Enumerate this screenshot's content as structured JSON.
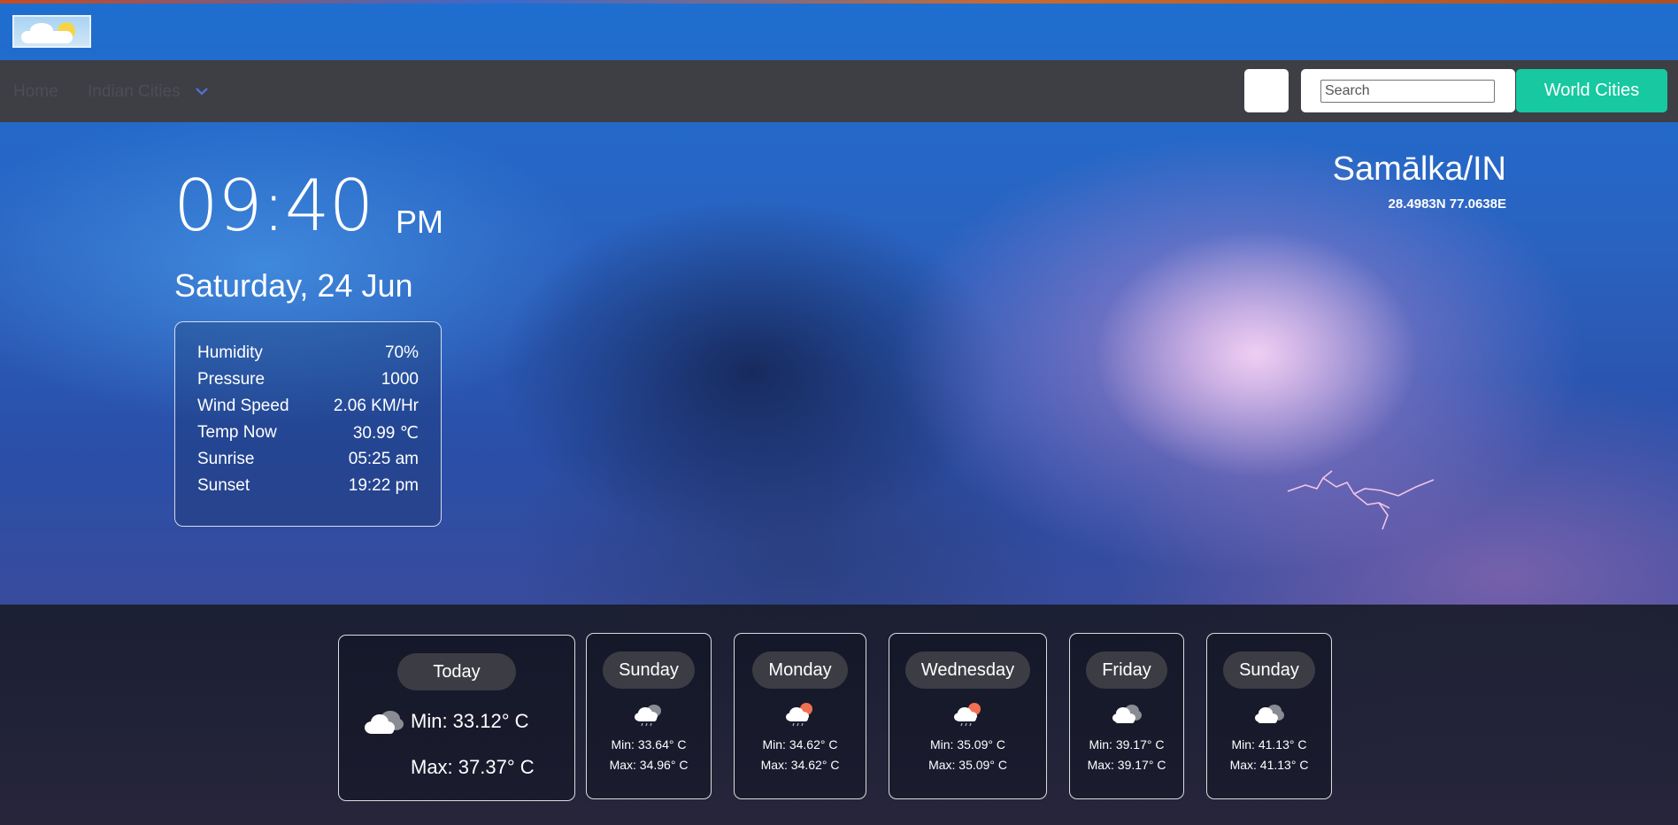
{
  "nav": {
    "home": "Home",
    "indian_cities": "Indian Cities",
    "search_placeholder": "Search",
    "world_cities": "World Cities"
  },
  "clock": {
    "time": "09:40",
    "ampm": "PM",
    "date": "Saturday, 24 Jun"
  },
  "stats": [
    {
      "label": "Humidity",
      "value": "70%"
    },
    {
      "label": "Pressure",
      "value": "1000"
    },
    {
      "label": "Wind Speed",
      "value": "2.06 KM/Hr"
    },
    {
      "label": "Temp Now",
      "value": "30.99 ℃"
    },
    {
      "label": "Sunrise",
      "value": "05:25 am"
    },
    {
      "label": "Sunset",
      "value": "19:22 pm"
    }
  ],
  "location": {
    "name": "Samālka/IN",
    "coords": "28.4983N 77.0638E"
  },
  "forecast": {
    "today": {
      "day": "Today",
      "min": "Min: 33.12° C",
      "max": "Max: 37.37° C",
      "icon": "cloudy-icon"
    },
    "days": [
      {
        "day": "Sunday",
        "min": "Min: 33.64° C",
        "max": "Max: 34.96° C",
        "icon": "rain-cloud-icon"
      },
      {
        "day": "Monday",
        "min": "Min: 34.62° C",
        "max": "Max: 34.62° C",
        "icon": "sun-rain-cloud-icon"
      },
      {
        "day": "Wednesday",
        "min": "Min: 35.09° C",
        "max": "Max: 35.09° C",
        "icon": "sun-rain-cloud-icon"
      },
      {
        "day": "Friday",
        "min": "Min: 39.17° C",
        "max": "Max: 39.17° C",
        "icon": "cloudy-icon"
      },
      {
        "day": "Sunday",
        "min": "Min: 41.13° C",
        "max": "Max: 41.13° C",
        "icon": "cloudy-icon"
      }
    ]
  },
  "colors": {
    "navbar": "#3d3f45",
    "world_button": "#17c8a0",
    "day_pill": "#3c3d44"
  }
}
